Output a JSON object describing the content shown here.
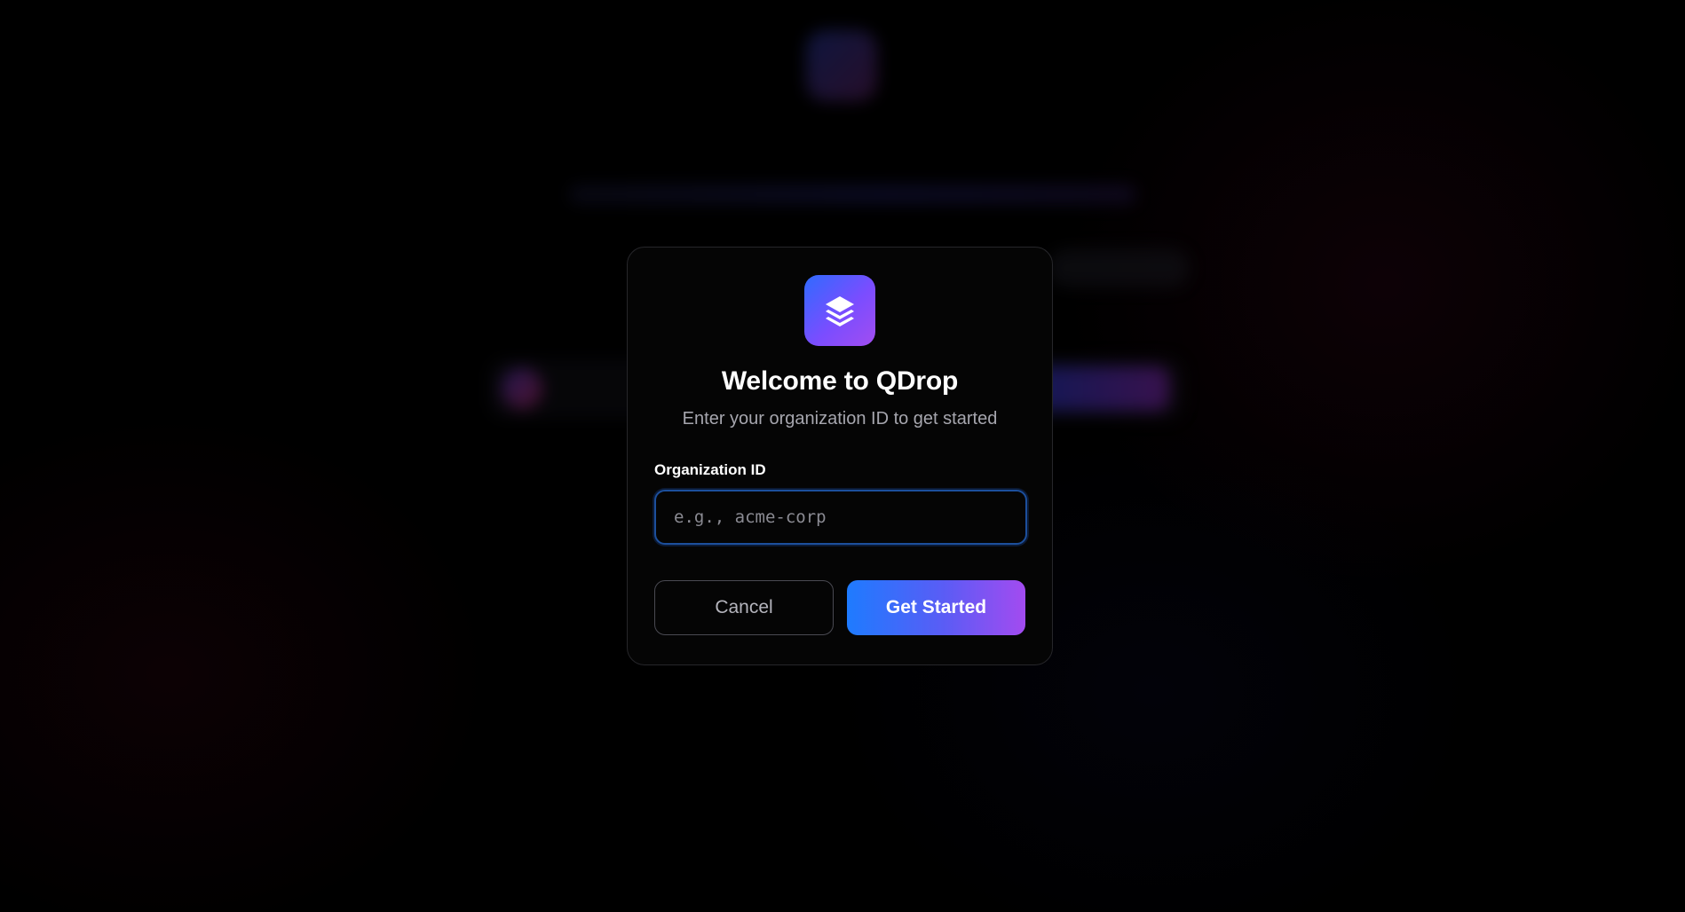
{
  "modal": {
    "icon": "layers-icon",
    "title": "Welcome to QDrop",
    "subtitle": "Enter your organization ID to get started",
    "field_label": "Organization ID",
    "input_value": "",
    "input_placeholder": "e.g., acme-corp",
    "cancel_label": "Cancel",
    "submit_label": "Get Started"
  },
  "colors": {
    "accent_blue": "#1e7bff",
    "accent_purple": "#a34bf0",
    "input_focus_border": "#1c4f9c",
    "background": "#000000"
  }
}
